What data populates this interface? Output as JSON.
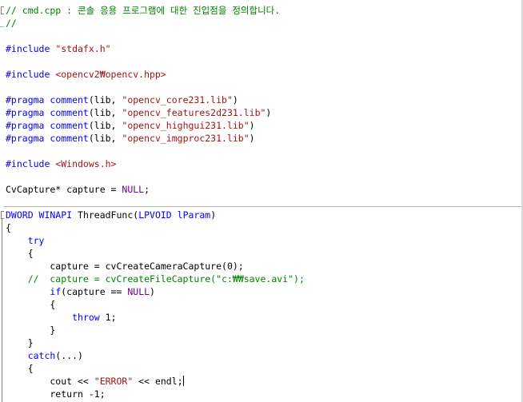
{
  "editor": {
    "language": "cpp",
    "lines": [
      [
        {
          "t": "// cmd.cpp : 콘솔 응용 프로그램에 대한 진입점을 정의합니다.",
          "c": "cm"
        }
      ],
      [
        {
          "t": "//",
          "c": "cm"
        }
      ],
      [],
      [
        {
          "t": "#include ",
          "c": "pp"
        },
        {
          "t": "\"stdafx.h\"",
          "c": "str"
        }
      ],
      [],
      [
        {
          "t": "#include ",
          "c": "pp"
        },
        {
          "t": "<opencv2₩opencv.hpp>",
          "c": "str"
        }
      ],
      [],
      [
        {
          "t": "#pragma ",
          "c": "pp"
        },
        {
          "t": "comment",
          "c": "pp"
        },
        {
          "t": "(lib, "
        },
        {
          "t": "\"opencv_core231.lib\"",
          "c": "str"
        },
        {
          "t": ")"
        }
      ],
      [
        {
          "t": "#pragma ",
          "c": "pp"
        },
        {
          "t": "comment",
          "c": "pp"
        },
        {
          "t": "(lib, "
        },
        {
          "t": "\"opencv_features2d231.lib\"",
          "c": "str"
        },
        {
          "t": ")"
        }
      ],
      [
        {
          "t": "#pragma ",
          "c": "pp"
        },
        {
          "t": "comment",
          "c": "pp"
        },
        {
          "t": "(lib, "
        },
        {
          "t": "\"opencv_highgui231.lib\"",
          "c": "str"
        },
        {
          "t": ")"
        }
      ],
      [
        {
          "t": "#pragma ",
          "c": "pp"
        },
        {
          "t": "comment",
          "c": "pp"
        },
        {
          "t": "(lib, "
        },
        {
          "t": "\"opencv_imgproc231.lib\"",
          "c": "str"
        },
        {
          "t": ")"
        }
      ],
      [],
      [
        {
          "t": "#include ",
          "c": "pp"
        },
        {
          "t": "<Windows.h>",
          "c": "str"
        }
      ],
      [],
      [
        {
          "t": "CvCapture* capture = "
        },
        {
          "t": "NULL",
          "c": "mac"
        },
        {
          "t": ";"
        }
      ],
      [],
      [
        {
          "t": "DWORD WINAPI ",
          "c": "kw"
        },
        {
          "t": "ThreadFunc("
        },
        {
          "t": "LPVOID lParam",
          "c": "kw"
        },
        {
          "t": ")"
        }
      ],
      [
        {
          "t": "{"
        }
      ],
      [
        {
          "t": "    "
        },
        {
          "t": "try",
          "c": "kw"
        }
      ],
      [
        {
          "t": "    {"
        }
      ],
      [
        {
          "t": "        capture = cvCreateCameraCapture(0);"
        }
      ],
      [
        {
          "t": "    //  capture = cvCreateFileCapture(\"c:₩₩save.avi\");",
          "c": "cm"
        }
      ],
      [
        {
          "t": "        "
        },
        {
          "t": "if",
          "c": "kw"
        },
        {
          "t": "(capture == "
        },
        {
          "t": "NULL",
          "c": "mac"
        },
        {
          "t": ")"
        }
      ],
      [
        {
          "t": "        {"
        }
      ],
      [
        {
          "t": "            "
        },
        {
          "t": "throw",
          "c": "kw"
        },
        {
          "t": " 1;"
        }
      ],
      [
        {
          "t": "        }"
        }
      ],
      [
        {
          "t": "    }"
        }
      ],
      [
        {
          "t": "    "
        },
        {
          "t": "catch",
          "c": "kw"
        },
        {
          "t": "(...)"
        }
      ],
      [
        {
          "t": "    {"
        }
      ],
      [
        {
          "t": "        cout << "
        },
        {
          "t": "\"ERROR\"",
          "c": "str"
        },
        {
          "t": " << endl;"
        },
        {
          "t": "",
          "c": "caret"
        }
      ],
      [
        {
          "t": "        return -1;"
        }
      ]
    ]
  },
  "colors": {
    "keyword": "#0000ff",
    "preprocessor": "#0000ff",
    "string": "#a31515",
    "comment": "#008000",
    "macro": "#6f008a",
    "text": "#000000",
    "background": "#ffffff"
  }
}
